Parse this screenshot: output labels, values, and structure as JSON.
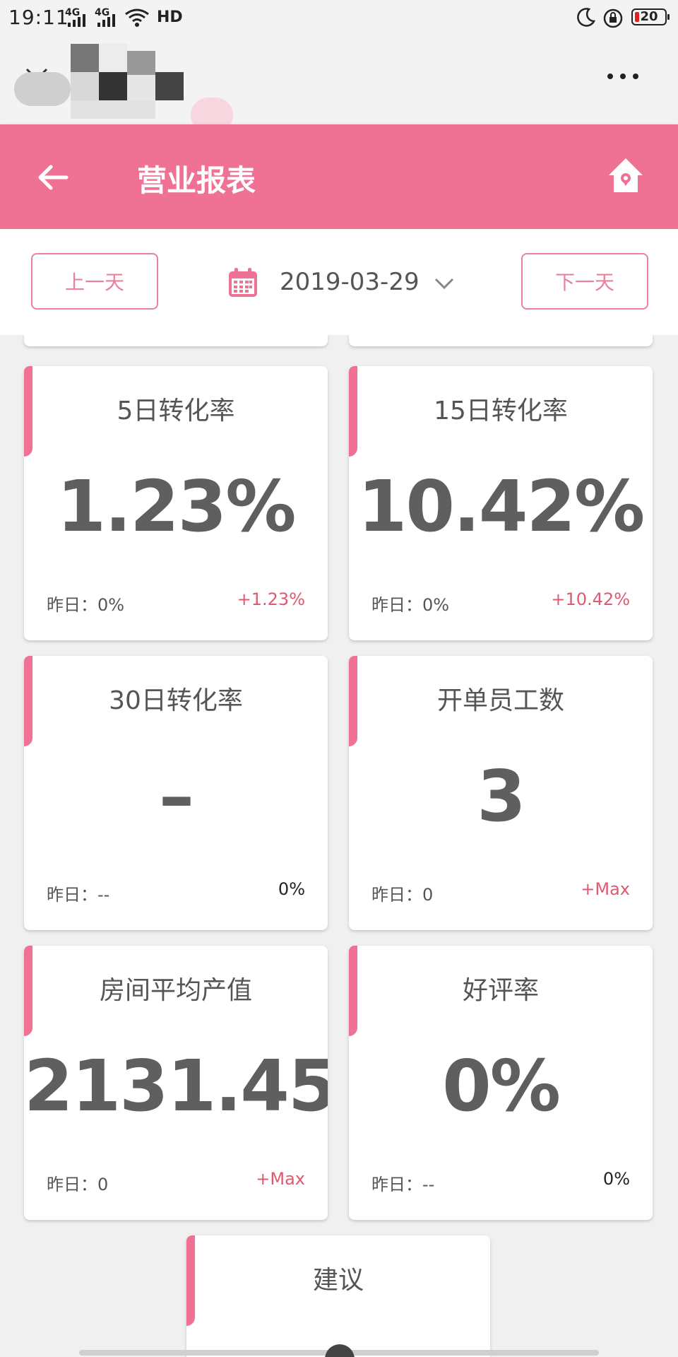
{
  "status_bar": {
    "time": "19:11",
    "network1": "4G",
    "network2": "4G",
    "hd": "HD",
    "battery": "20"
  },
  "app_bar": {
    "title": "营业报表"
  },
  "date_bar": {
    "prev_label": "上一天",
    "date": "2019-03-29",
    "next_label": "下一天"
  },
  "cards": [
    {
      "title": "5日转化率",
      "value": "1.23%",
      "yesterday": "昨日：0%",
      "delta": "+1.23%",
      "delta_color": "#e05a6f"
    },
    {
      "title": "15日转化率",
      "value": "10.42%",
      "yesterday": "昨日：0%",
      "delta": "+10.42%",
      "delta_color": "#e05a6f"
    },
    {
      "title": "30日转化率",
      "value": "–",
      "yesterday": "昨日：--",
      "delta": "0%",
      "delta_color": "#222222"
    },
    {
      "title": "开单员工数",
      "value": "3",
      "yesterday": "昨日：0",
      "delta": "+Max",
      "delta_color": "#e05a6f"
    },
    {
      "title": "房间平均产值",
      "value": "2131.45",
      "yesterday": "昨日：0",
      "delta": "+Max",
      "delta_color": "#e05a6f"
    },
    {
      "title": "好评率",
      "value": "0%",
      "yesterday": "昨日：--",
      "delta": "0%",
      "delta_color": "#222222"
    }
  ],
  "suggestion_card": {
    "title": "建议"
  },
  "colors": {
    "accent": "#ef7193",
    "delta_positive": "#e05a6f"
  }
}
